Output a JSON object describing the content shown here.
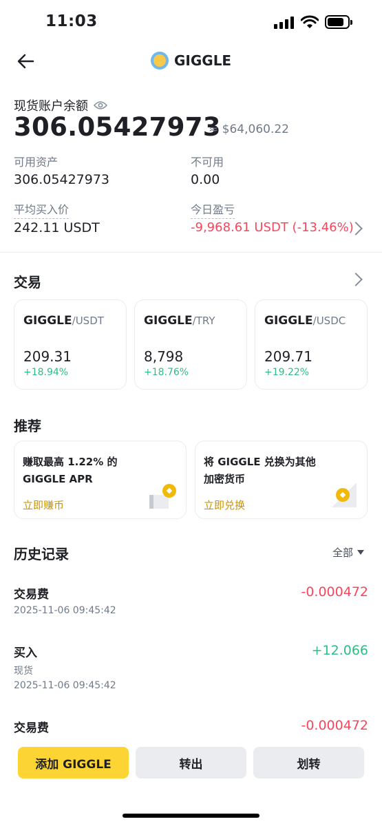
{
  "status_bar": {
    "time": "11:03"
  },
  "header": {
    "title": "GIGGLE"
  },
  "balance": {
    "label": "现货账户余额",
    "amount": "306.05427973",
    "usd_value": "≈ $64,060.22",
    "available_label": "可用资产",
    "available_value": "306.05427973",
    "unavailable_label": "不可用",
    "unavailable_value": "0.00",
    "avg_price_label": "平均买入价",
    "avg_price_value": "242.11 USDT",
    "pnl_label": "今日盈亏",
    "pnl_value": "-9,968.61 USDT (-13.46%)"
  },
  "trade": {
    "title": "交易",
    "pairs": [
      {
        "base": "GIGGLE",
        "quote": "/USDT",
        "price": "209.31",
        "change": "+18.94%"
      },
      {
        "base": "GIGGLE",
        "quote": "/TRY",
        "price": "8,798",
        "change": "+18.76%"
      },
      {
        "base": "GIGGLE",
        "quote": "/USDC",
        "price": "209.71",
        "change": "+19.22%"
      }
    ]
  },
  "recommend": {
    "title": "推荐",
    "cards": [
      {
        "line1": "赚取最高 1.22% 的",
        "line2": "GIGGLE APR",
        "link": "立即赚币"
      },
      {
        "line1": "将 GIGGLE 兑换为其他",
        "line2": "加密货币",
        "link": "立即兑换"
      }
    ]
  },
  "history": {
    "title": "历史记录",
    "filter": "全部",
    "items": [
      {
        "type": "交易费",
        "sub": "",
        "time": "2025-11-06 09:45:42",
        "amount": "-0.000472"
      },
      {
        "type": "买入",
        "sub": "现货",
        "time": "2025-11-06 09:45:42",
        "amount": "+12.066"
      },
      {
        "type": "交易费",
        "sub": "",
        "time": "",
        "amount": "-0.000472"
      }
    ]
  },
  "actions": {
    "add": "添加 GIGGLE",
    "withdraw": "转出",
    "transfer": "划转"
  },
  "colors": {
    "accent": "#fcd535",
    "up": "#2ebd85",
    "down": "#f6465d",
    "link": "#c99400"
  }
}
